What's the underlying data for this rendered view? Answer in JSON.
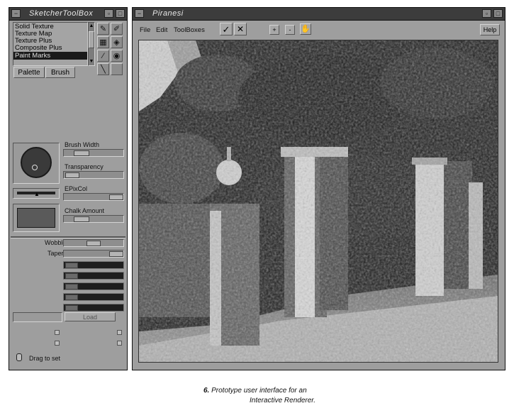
{
  "toolbox": {
    "title": "SketcherToolBox",
    "list_items": [
      "Solid Texture",
      "Texture Map",
      "Texture Plus",
      "Composite Plus",
      "Paint Marks"
    ],
    "selected_item": "Paint Marks",
    "tabs": [
      "Palette",
      "Brush"
    ],
    "params": {
      "brush_width": "Brush Width",
      "transparency": "Transparency",
      "epixcol": "EPixCol",
      "chalk_amount": "Chalk Amount",
      "wobble": "Wobble",
      "taper": "Taper"
    },
    "load_label": "Load",
    "drag_hint": "Drag to set"
  },
  "main": {
    "title": "Piranesi",
    "menu": [
      "File",
      "Edit",
      "ToolBoxes"
    ],
    "confirm_glyph": "✓",
    "cancel_glyph": "✕",
    "zoom_in": "+",
    "zoom_out": "-",
    "help_label": "Help"
  },
  "caption": {
    "number": "6.",
    "line1": "Prototype user interface for an",
    "line2": "Interactive Renderer."
  },
  "icons": {
    "window_menu": "minus-icon",
    "window_max": "square-icon",
    "tools": [
      "brush-icon",
      "pencil-icon",
      "grid-icon",
      "bucket-icon",
      "wand-icon",
      "globe-icon",
      "dropper-icon",
      "blank-tool"
    ],
    "hand": "hand-icon",
    "mouse": "mouse-icon"
  }
}
